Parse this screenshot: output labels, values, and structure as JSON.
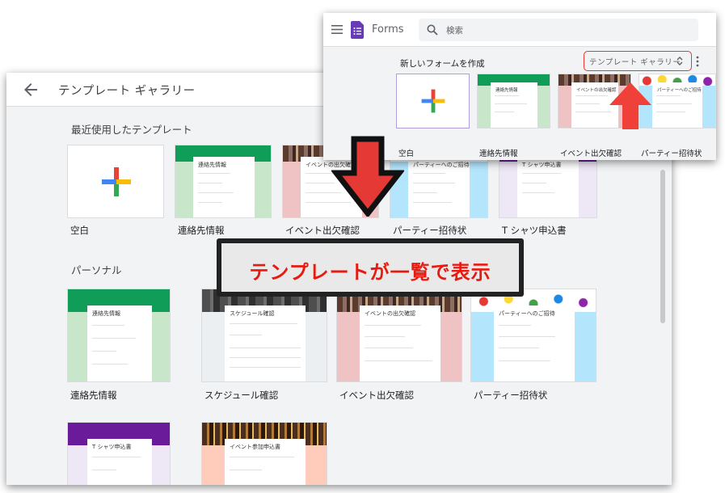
{
  "colors": {
    "accent_red": "#e53935",
    "forms_purple": "#673ab7",
    "contact_green": "#0f9d58",
    "tshirt_purple": "#6a1b9a"
  },
  "gallery": {
    "title": "テンプレート ギャラリー",
    "back_icon": "arrow-back-icon",
    "recent_title": "最近使用したテンプレート",
    "recent": [
      {
        "name": "空白"
      },
      {
        "name": "連絡先情報",
        "card_title": "連絡先情報"
      },
      {
        "name": "イベント出欠確認",
        "card_title": "イベントの出欠確認"
      },
      {
        "name": "パーティー招待状",
        "card_title": "パーティーへのご招待"
      },
      {
        "name": "T シャツ申込書",
        "card_title": "T シャツ申込書"
      }
    ],
    "personal_title": "パーソナル",
    "personal": [
      {
        "name": "連絡先情報",
        "card_title": "連絡先情報"
      },
      {
        "name": "スケジュール確認",
        "card_title": "スケジュール確認"
      },
      {
        "name": "イベント出欠確認",
        "card_title": "イベントの出欠確認"
      },
      {
        "name": "パーティー招待状",
        "card_title": "パーティーへのご招待"
      }
    ],
    "personal_row2": [
      {
        "card_title": "T シャツ申込書"
      },
      {
        "card_title": "イベント参加申込書"
      }
    ]
  },
  "forms": {
    "app_name": "Forms",
    "menu_icon": "hamburger-menu-icon",
    "search_placeholder": "検索",
    "new_form_title": "新しいフォームを作成",
    "gallery_button_label": "テンプレート ギャラリー",
    "templates": [
      {
        "name": "空白"
      },
      {
        "name": "連絡先情報",
        "card_title": "連絡先情報"
      },
      {
        "name": "イベント出欠確認",
        "card_title": "イベントの出欠確認"
      },
      {
        "name": "パーティー招待状",
        "card_title": "パーティーへのご招待"
      }
    ]
  },
  "callout": {
    "text": "テンプレートが一覧で表示"
  }
}
